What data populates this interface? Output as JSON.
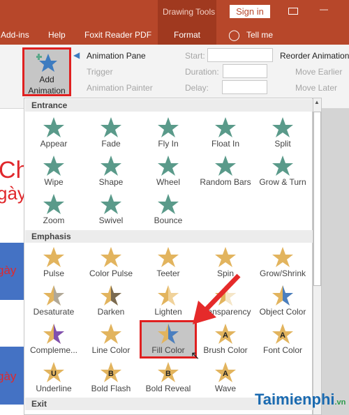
{
  "titlebar": {
    "context_group": "Drawing Tools",
    "sign_in": "Sign in",
    "minimize": "—"
  },
  "tabs": [
    {
      "label": "Add-ins"
    },
    {
      "label": "Help"
    },
    {
      "label": "Foxit Reader PDF"
    },
    {
      "label": "Format"
    },
    {
      "label": "Tell me"
    }
  ],
  "ribbon": {
    "add_animation": "Add",
    "add_animation_2": "Animation",
    "animation_pane": "Animation Pane",
    "trigger": "Trigger",
    "animation_painter": "Animation Painter",
    "start": "Start:",
    "duration": "Duration:",
    "delay": "Delay:",
    "reorder": "Reorder Animation",
    "move_earlier": "Move Earlier",
    "move_later": "Move Later"
  },
  "slide": {
    "text1": "Ch",
    "text2": "gày",
    "text3": "gày",
    "text4": "gày"
  },
  "colors": {
    "accent": "#b7472a",
    "entrance": "#5a9a8a",
    "emphasis": "#e2b45e",
    "highlight": "#e02020"
  },
  "gallery": {
    "entrance_label": "Entrance",
    "entrance": [
      {
        "label": "Appear"
      },
      {
        "label": "Fade"
      },
      {
        "label": "Fly In"
      },
      {
        "label": "Float In"
      },
      {
        "label": "Split"
      },
      {
        "label": "Wipe"
      },
      {
        "label": "Shape"
      },
      {
        "label": "Wheel"
      },
      {
        "label": "Random Bars"
      },
      {
        "label": "Grow & Turn"
      },
      {
        "label": "Zoom"
      },
      {
        "label": "Swivel"
      },
      {
        "label": "Bounce"
      }
    ],
    "emphasis_label": "Emphasis",
    "emphasis": [
      {
        "label": "Pulse"
      },
      {
        "label": "Color Pulse"
      },
      {
        "label": "Teeter"
      },
      {
        "label": "Spin"
      },
      {
        "label": "Grow/Shrink"
      },
      {
        "label": "Desaturate",
        "second": "#b0a898"
      },
      {
        "label": "Darken",
        "second": "#7a6a50"
      },
      {
        "label": "Lighten",
        "second": "#f0d29a"
      },
      {
        "label": "Transparency",
        "second": "#f5e6c8"
      },
      {
        "label": "Object Color",
        "second": "#4a7fc0"
      },
      {
        "label": "Compleme...",
        "second": "#8050b0"
      },
      {
        "label": "Line Color"
      },
      {
        "label": "Fill Color",
        "second": "#4a7fc0",
        "selected": true
      },
      {
        "label": "Brush Color",
        "letter": "A"
      },
      {
        "label": "Font Color",
        "letter": "A"
      },
      {
        "label": "Underline",
        "letter": "U"
      },
      {
        "label": "Bold Flash",
        "letter": "B"
      },
      {
        "label": "Bold Reveal",
        "letter": "B"
      },
      {
        "label": "Wave",
        "letter": "A"
      }
    ],
    "exit_label": "Exit"
  },
  "watermark": "Taimienphi.vn"
}
